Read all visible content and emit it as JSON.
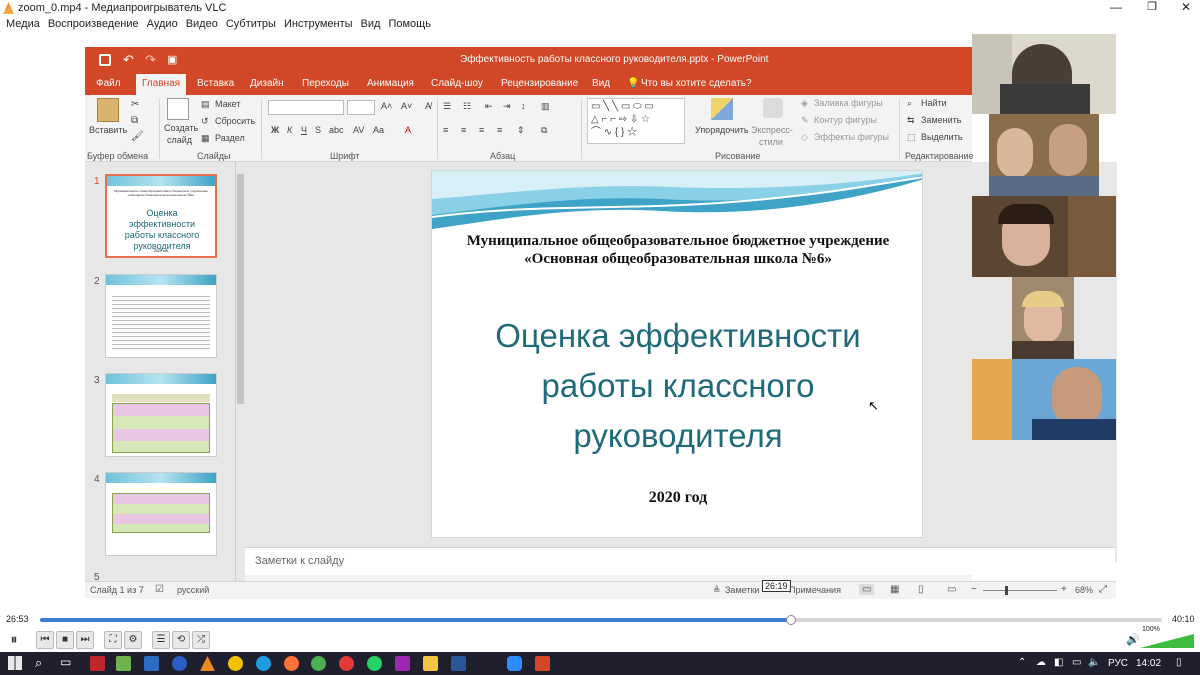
{
  "vlc": {
    "title": "zoom_0.mp4 - Медиапроигрыватель VLC",
    "menu": [
      "Медиа",
      "Воспроизведение",
      "Аудио",
      "Видео",
      "Субтитры",
      "Инструменты",
      "Вид",
      "Помощь"
    ],
    "time_elapsed": "26:53",
    "time_total": "40:10",
    "progress": 0.669,
    "volume": "100%",
    "volume_level": 1.0
  },
  "ppt": {
    "title": "Эффективность работы классного руководителя.pptx - PowerPoint",
    "tabs": [
      "Файл",
      "Главная",
      "Вставка",
      "Дизайн",
      "Переходы",
      "Анимация",
      "Слайд-шоу",
      "Рецензирование",
      "Вид"
    ],
    "tell_me": "Что вы хотите сделать?",
    "ribbon": {
      "paste": "Вставить",
      "new_slide_1": "Создать",
      "new_slide_2": "слайд",
      "layout": "Макет",
      "reset": "Сбросить",
      "section": "Раздел",
      "arrange": "Упорядочить",
      "quick_styles_1": "Экспресс-",
      "quick_styles_2": "стили",
      "shape_fill": "Заливка фигуры",
      "shape_outline": "Контур фигуры",
      "shape_effects": "Эффекты фигуры",
      "find": "Найти",
      "replace": "Заменить",
      "select": "Выделить",
      "font_b": "Ж",
      "font_i": "К",
      "font_u": "Ч",
      "font_s": "S",
      "groups": [
        "Буфер обмена",
        "Слайды",
        "Шрифт",
        "Абзац",
        "Рисование",
        "Редактирование"
      ]
    },
    "thumb_numbers": [
      "1",
      "2",
      "3",
      "4",
      "5"
    ],
    "thumb1": {
      "small_header": "Муниципальное общеобразовательное бюджетное учреждение «Основная общеобразовательная школа №6»",
      "title": "Оценка эффективности работы классного руководителя",
      "year": "2020 год"
    },
    "slide": {
      "org_line1": "Муниципальное общеобразовательное бюджетное учреждение",
      "org_line2": "«Основная общеобразовательная школа №6»",
      "title_line1": "Оценка эффективности",
      "title_line2": "работы классного",
      "title_line3": "руководителя",
      "year": "2020 год"
    },
    "notes_placeholder": "Заметки к слайду",
    "status": {
      "slide_count": "Слайд 1 из 7",
      "language": "русский",
      "notes": "Заметки",
      "comments": "Примечания",
      "zoom": "68%",
      "timestamp": "26:19"
    }
  },
  "taskbar": {
    "lang": "РУС",
    "clock": "14:02"
  },
  "colors": {
    "ppt_accent": "#d24726",
    "title_teal": "#1f6b7a",
    "seek_blue": "#3a7fd0"
  }
}
